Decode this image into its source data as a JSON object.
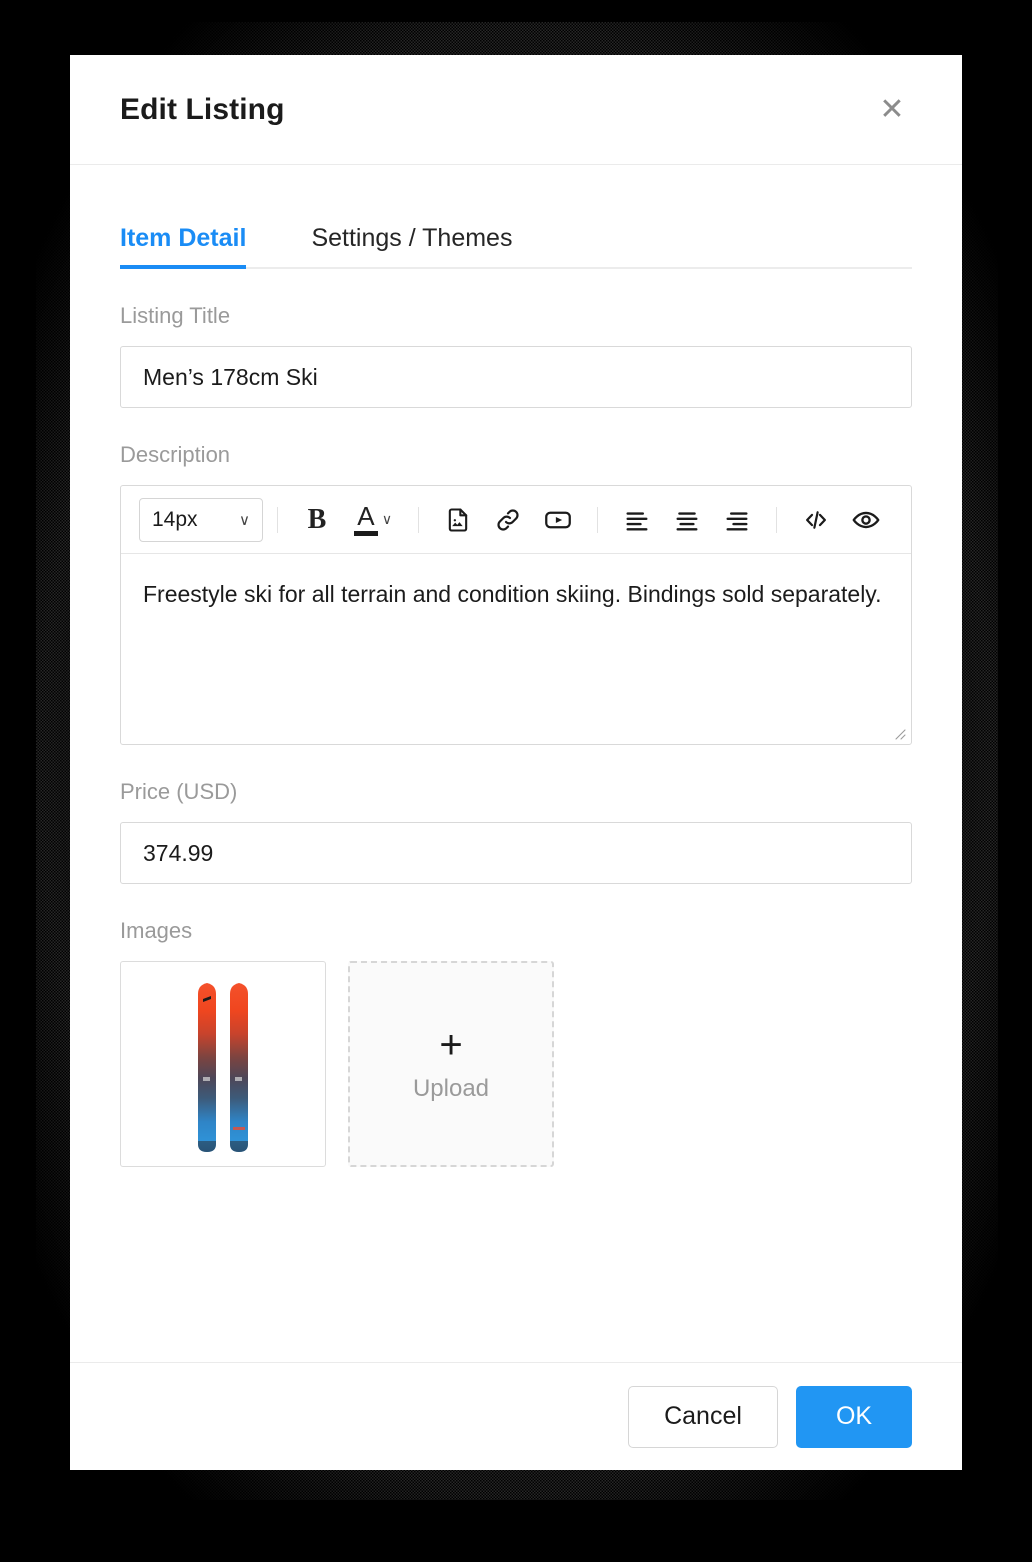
{
  "dialog": {
    "title": "Edit Listing",
    "close_icon": "close-icon",
    "close_glyph": "✕"
  },
  "tabs": [
    {
      "label": "Item Detail",
      "active": true
    },
    {
      "label": "Settings / Themes",
      "active": false
    }
  ],
  "fields": {
    "listing_title": {
      "label": "Listing Title",
      "value": "Men’s 178cm Ski",
      "placeholder": ""
    },
    "description": {
      "label": "Description",
      "value": "Freestyle ski for all terrain and condition skiing. Bindings sold separately.",
      "placeholder": ""
    },
    "price": {
      "label": "Price (USD)",
      "value": "374.99",
      "placeholder": ""
    },
    "images": {
      "label": "Images"
    }
  },
  "editor_toolbar": {
    "font_size_value": "14px",
    "font_size_chevron": "∨",
    "bold_label": "B",
    "text_color_label": "A",
    "text_color_chevron": "∨",
    "text_color_swatch": "#1b1b1b",
    "icons": [
      "image-icon",
      "link-icon",
      "video-icon",
      "align-left-icon",
      "align-center-icon",
      "align-right-icon",
      "code-icon",
      "preview-eye-icon"
    ]
  },
  "upload": {
    "plus_glyph": "+",
    "label": "Upload"
  },
  "thumbnail": {
    "alt": "pair-of-skis",
    "tip_color": "#f3502a",
    "mid_color": "#4a3b4a",
    "tail_color": "#2f8fd6"
  },
  "footer": {
    "cancel_label": "Cancel",
    "ok_label": "OK"
  },
  "colors": {
    "accent": "#2196f3",
    "tab_active": "#1a8cf5",
    "label_gray": "#9a9a9a",
    "border": "#d9d9d9",
    "backdrop": "#000000"
  }
}
